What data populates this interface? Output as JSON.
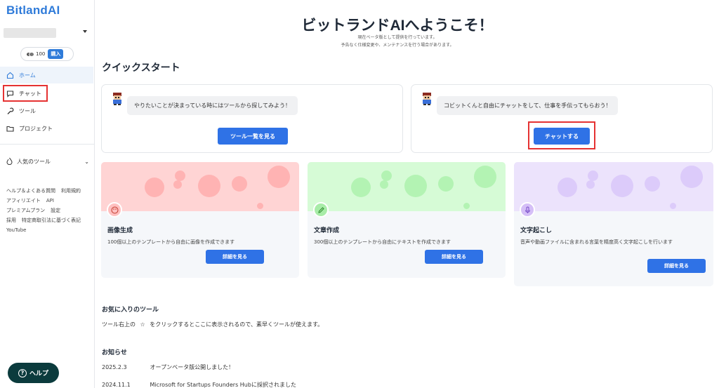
{
  "app": {
    "logo": "BitlandAI"
  },
  "credits": {
    "amount": "100",
    "buy_label": "購入"
  },
  "sidebar": {
    "items": [
      {
        "label": "ホーム",
        "icon": "home-icon"
      },
      {
        "label": "チャット",
        "icon": "chat-icon"
      },
      {
        "label": "ツール",
        "icon": "wrench-icon"
      },
      {
        "label": "プロジェクト",
        "icon": "folder-icon"
      }
    ],
    "popular_tools": "人気のツール",
    "footer_links": [
      "ヘルプ＆よくある質問",
      "利用規約",
      "アフィリエイト",
      "API",
      "プレミアムプラン",
      "設定",
      "採用",
      "特定商取引法に基づく表記",
      "YouTube"
    ],
    "help_label": "ヘルプ"
  },
  "main": {
    "welcome_title": "ビットランドAIへようこそ！",
    "welcome_sub1": "現在ベータ版として提供を行っています。",
    "welcome_sub2": "予告なく仕様変更や、メンテナンスを行う場合があります。",
    "quickstart_title": "クイックスタート",
    "quickstart": [
      {
        "message": "やりたいことが決まっている時にはツールから探してみよう！",
        "button": "ツール一覧を見る"
      },
      {
        "message": "コビットくんと自由にチャットをして、仕事を手伝ってもらおう！",
        "button": "チャットする"
      }
    ],
    "features": [
      {
        "title": "画像生成",
        "desc": "100個以上のテンプレートから自由に画像を作成できます",
        "button": "詳細を見る",
        "color": "#ffc9c9",
        "icon": "palette-icon"
      },
      {
        "title": "文章作成",
        "desc": "300個以上のテンプレートから自由にテキストを作成できます",
        "button": "詳細を見る",
        "color": "#c9f7c9",
        "icon": "pencil-icon"
      },
      {
        "title": "文字起こし",
        "desc": "音声や動画ファイルに含まれる言葉を精度高く文字起こしを行います",
        "button": "詳細を見る",
        "color": "#e3d7fb",
        "icon": "microphone-icon"
      }
    ],
    "favorites_title": "お気に入りのツール",
    "favorites_text_before": "ツール右上の",
    "favorites_star": "☆",
    "favorites_text_after": "をクリックするとここに表示されるので、素早くツールが使えます。",
    "news_title": "お知らせ",
    "news": [
      {
        "date": "2025.2.3",
        "text": "オープンベータ版公開しました！"
      },
      {
        "date": "2024.11.1",
        "text": "Microsoft for Startups Founders Hubに採択されました"
      }
    ]
  }
}
